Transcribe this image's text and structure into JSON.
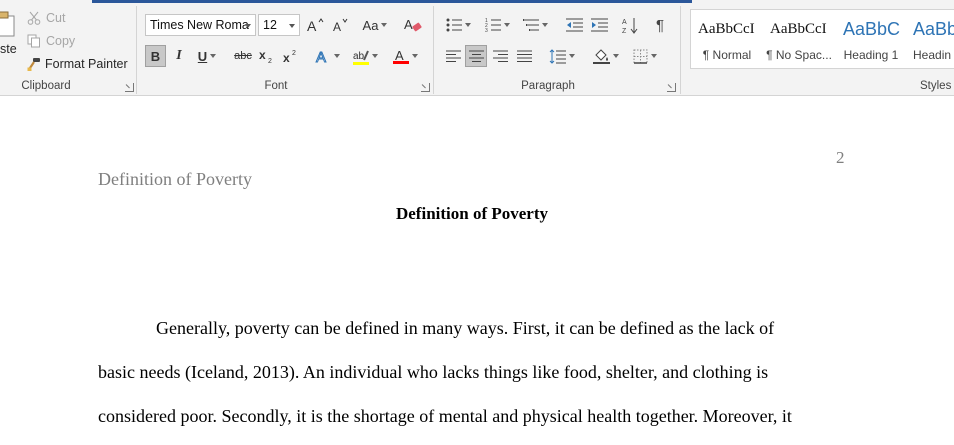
{
  "clipboard": {
    "label": "Clipboard",
    "paste_label": "ste",
    "cut_label": "Cut",
    "copy_label": "Copy",
    "format_painter_label": "Format Painter"
  },
  "font": {
    "label": "Font",
    "font_name": "Times New Roma",
    "font_size": "12",
    "change_case_label": "Aa",
    "bold_label": "B",
    "italic_label": "I",
    "underline_label": "U",
    "strikethrough_label": "abc",
    "highlight_color": "#ffff00",
    "font_color": "#ff0000"
  },
  "paragraph": {
    "label": "Paragraph"
  },
  "styles": {
    "label": "Styles",
    "items": [
      {
        "preview": "AaBbCcI",
        "name": "¶ Normal"
      },
      {
        "preview": "AaBbCcI",
        "name": "¶ No Spac..."
      },
      {
        "preview": "AaBbC",
        "name": "Heading 1"
      },
      {
        "preview": "AaBb",
        "name": "Headin"
      }
    ]
  },
  "document": {
    "page_number": "2",
    "running_head": "Definition of Poverty",
    "title": "Definition of Poverty",
    "lines": [
      "Generally, poverty can be defined in many ways. First, it can be defined as the lack of",
      "basic needs (Iceland, 2013). An individual who lacks things like food, shelter, and clothing is",
      "considered poor. Secondly, it is the shortage of mental and physical health together. Moreover, it"
    ]
  },
  "colors": {
    "accent": "#2b579a",
    "heading_style": "#2e74b5"
  }
}
